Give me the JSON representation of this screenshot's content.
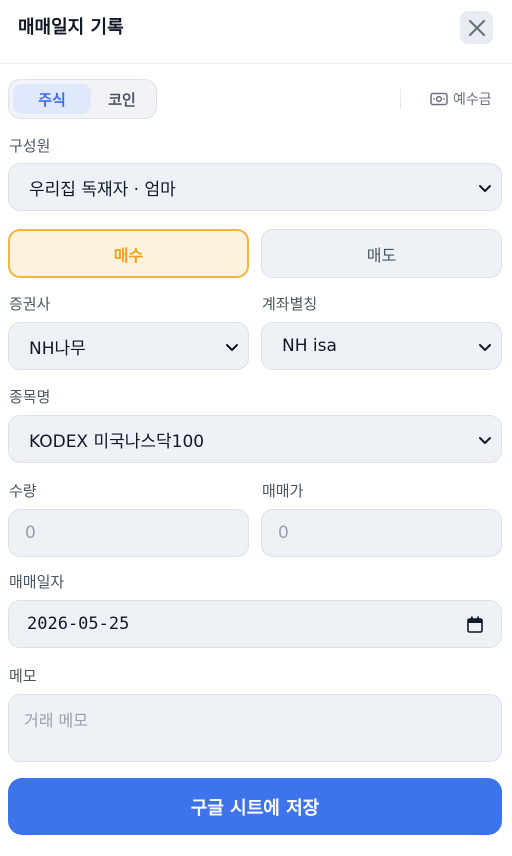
{
  "header": {
    "title": "매매일지 기록",
    "close_icon": "close-icon"
  },
  "asset_tabs": [
    {
      "label": "주식",
      "active": true
    },
    {
      "label": "코인",
      "active": false
    }
  ],
  "deposit": {
    "label": "예수금",
    "icon": "cash-icon"
  },
  "member": {
    "label": "구성원",
    "value": "우리집 독재자 · 엄마"
  },
  "trade_type": {
    "buy_label": "매수",
    "sell_label": "매도",
    "selected": "매수"
  },
  "broker": {
    "label": "증권사",
    "value": "NH나무"
  },
  "account": {
    "label": "계좌별칭",
    "value": "NH isa"
  },
  "stock": {
    "label": "종목명",
    "value": "KODEX 미국나스닥100"
  },
  "quantity": {
    "label": "수량",
    "placeholder": "0"
  },
  "price": {
    "label": "매매가",
    "placeholder": "0"
  },
  "date": {
    "label": "매매일자",
    "value": "2026-05-25"
  },
  "memo": {
    "label": "메모",
    "placeholder": "거래 메모"
  },
  "save_button": {
    "label": "구글 시트에 저장"
  },
  "colors": {
    "accent": "#3d74eb",
    "buy": "#f2a01b",
    "buy_bg": "#fdf2dc",
    "field_bg": "#eef1f6"
  }
}
